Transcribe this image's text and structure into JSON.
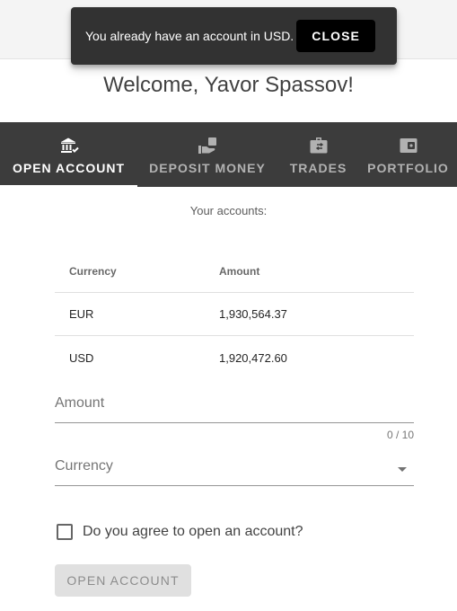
{
  "snackbar": {
    "message": "You already have an account in USD.",
    "action_label": "CLOSE"
  },
  "welcome_text": "Welcome, Yavor Spassov!",
  "tabs": [
    {
      "label": "OPEN ACCOUNT",
      "icon": "bank-icon",
      "active": true
    },
    {
      "label": "DEPOSIT MONEY",
      "icon": "hand-money-icon",
      "active": false
    },
    {
      "label": "TRADES",
      "icon": "briefcase-exchange-icon",
      "active": false
    },
    {
      "label": "PORTFOLIO",
      "icon": "wallet-icon",
      "active": false
    }
  ],
  "accounts": {
    "caption": "Your accounts:",
    "columns": [
      "Currency",
      "Amount"
    ],
    "rows": [
      {
        "currency": "EUR",
        "amount": "1,930,564.37"
      },
      {
        "currency": "USD",
        "amount": "1,920,472.60"
      }
    ]
  },
  "form": {
    "amount_label": "Amount",
    "amount_counter": "0 / 10",
    "currency_label": "Currency",
    "agree_label": "Do you agree to open an account?",
    "agree_checked": false,
    "submit_label": "OPEN ACCOUNT"
  },
  "colors": {
    "tab_bar": "#3c3c3c",
    "snackbar": "#323232",
    "snackbar_action_bg": "#000000",
    "disabled_button": "#e0e0e0"
  }
}
